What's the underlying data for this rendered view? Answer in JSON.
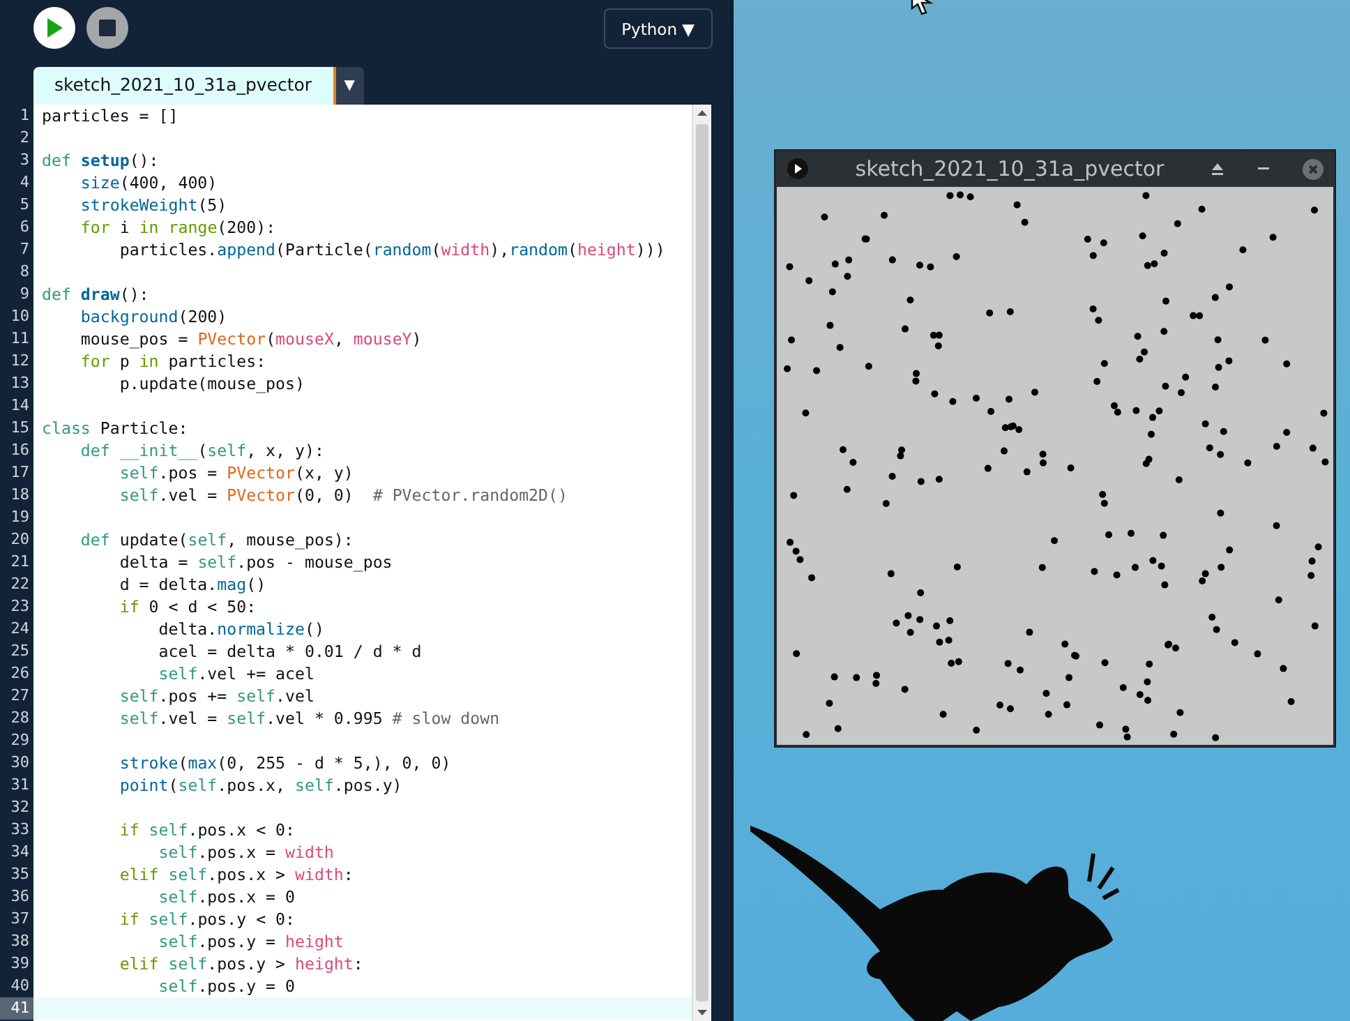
{
  "toolbar": {
    "language": "Python ▼"
  },
  "tabs": [
    {
      "label": "sketch_2021_10_31a_pvector",
      "selected": true
    }
  ],
  "tab_menu": "▼",
  "editor": {
    "lines": [
      {
        "number": "1",
        "current": false,
        "tokens": [
          {
            "t": "particles = []",
            "color": "#111111"
          }
        ]
      },
      {
        "number": "2",
        "current": false
      },
      {
        "number": "3",
        "current": false,
        "tokens": [
          {
            "t": "def ",
            "color": "#33997e"
          },
          {
            "t": "**setup**",
            "color": "#006699"
          },
          {
            "t": "():",
            "color": "#111111"
          }
        ]
      },
      {
        "number": "4",
        "current": false,
        "tokens": [
          {
            "t": "    size",
            "color": "#006699"
          },
          {
            "t": "(400, 400)",
            "color": "#111111"
          }
        ]
      },
      {
        "number": "5",
        "current": false,
        "tokens": [
          {
            "t": "    strokeWeight",
            "color": "#006699"
          },
          {
            "t": "(5)",
            "color": "#111111"
          }
        ]
      },
      {
        "number": "6",
        "current": false,
        "tokens": [
          {
            "t": "    for",
            "color": "#669900"
          },
          {
            "t": " i ",
            "color": "#111111"
          },
          {
            "t": "in range",
            "color": "#669900"
          },
          {
            "t": "(200):",
            "color": "#111111"
          }
        ]
      },
      {
        "number": "7",
        "current": false,
        "tokens": [
          {
            "t": "        particles.",
            "color": "#111111"
          },
          {
            "t": "append",
            "color": "#006699"
          },
          {
            "t": "(Particle(",
            "color": "#111111"
          },
          {
            "t": "random",
            "color": "#006699"
          },
          {
            "t": "(",
            "color": "#111111"
          },
          {
            "t": "width",
            "color": "#d94a7a"
          },
          {
            "t": "),",
            "color": "#111111"
          },
          {
            "t": "random",
            "color": "#006699"
          },
          {
            "t": "(",
            "color": "#111111"
          },
          {
            "t": "height",
            "color": "#d94a7a"
          },
          {
            "t": ")))",
            "color": "#111111"
          }
        ]
      },
      {
        "number": "8",
        "current": false
      },
      {
        "number": "9",
        "current": false,
        "tokens": [
          {
            "t": "def ",
            "color": "#33997e"
          },
          {
            "t": "**draw**",
            "color": "#006699"
          },
          {
            "t": "():",
            "color": "#111111"
          }
        ]
      },
      {
        "number": "10",
        "current": false,
        "tokens": [
          {
            "t": "    background",
            "color": "#006699"
          },
          {
            "t": "(200)",
            "color": "#111111"
          }
        ]
      },
      {
        "number": "11",
        "current": false,
        "tokens": [
          {
            "t": "    mouse_pos = ",
            "color": "#111111"
          },
          {
            "t": "PVector",
            "color": "#e2661a"
          },
          {
            "t": "(",
            "color": "#111111"
          },
          {
            "t": "mouseX",
            "color": "#d94a7a"
          },
          {
            "t": ", ",
            "color": "#111111"
          },
          {
            "t": "mouseY",
            "color": "#d94a7a"
          },
          {
            "t": ")",
            "color": "#111111"
          }
        ]
      },
      {
        "number": "12",
        "current": false,
        "tokens": [
          {
            "t": "    for",
            "color": "#669900"
          },
          {
            "t": " p ",
            "color": "#111111"
          },
          {
            "t": "in",
            "color": "#669900"
          },
          {
            "t": " particles:",
            "color": "#111111"
          }
        ]
      },
      {
        "number": "13",
        "current": false,
        "tokens": [
          {
            "t": "        p.update(mouse_pos)",
            "color": "#111111"
          }
        ]
      },
      {
        "number": "14",
        "current": false
      },
      {
        "number": "15",
        "current": false,
        "tokens": [
          {
            "t": "class",
            "color": "#33997e"
          },
          {
            "t": " Particle:",
            "color": "#111111"
          }
        ]
      },
      {
        "number": "16",
        "current": false,
        "tokens": [
          {
            "t": "    def __init__",
            "color": "#33997e"
          },
          {
            "t": "(",
            "color": "#111111"
          },
          {
            "t": "self",
            "color": "#33997e"
          },
          {
            "t": ", x, y):",
            "color": "#111111"
          }
        ]
      },
      {
        "number": "17",
        "current": false,
        "tokens": [
          {
            "t": "        self",
            "color": "#33997e"
          },
          {
            "t": ".pos = ",
            "color": "#111111"
          },
          {
            "t": "PVector",
            "color": "#e2661a"
          },
          {
            "t": "(x, y)",
            "color": "#111111"
          }
        ]
      },
      {
        "number": "18",
        "current": false,
        "tokens": [
          {
            "t": "        self",
            "color": "#33997e"
          },
          {
            "t": ".vel = ",
            "color": "#111111"
          },
          {
            "t": "PVector",
            "color": "#e2661a"
          },
          {
            "t": "(0, 0)",
            "color": "#111111"
          },
          {
            "t": "  # PVector.random2D()",
            "color": "#666666"
          }
        ]
      },
      {
        "number": "19",
        "current": false
      },
      {
        "number": "20",
        "current": false,
        "tokens": [
          {
            "t": "    def",
            "color": "#33997e"
          },
          {
            "t": " update(",
            "color": "#111111"
          },
          {
            "t": "self",
            "color": "#33997e"
          },
          {
            "t": ", mouse_pos):",
            "color": "#111111"
          }
        ]
      },
      {
        "number": "21",
        "current": false,
        "tokens": [
          {
            "t": "        delta = ",
            "color": "#111111"
          },
          {
            "t": "self",
            "color": "#33997e"
          },
          {
            "t": ".pos - mouse_pos",
            "color": "#111111"
          }
        ]
      },
      {
        "number": "22",
        "current": false,
        "tokens": [
          {
            "t": "        d = delta.",
            "color": "#111111"
          },
          {
            "t": "mag",
            "color": "#006699"
          },
          {
            "t": "()",
            "color": "#111111"
          }
        ]
      },
      {
        "number": "23",
        "current": false,
        "tokens": [
          {
            "t": "        if",
            "color": "#669900"
          },
          {
            "t": " 0 < d < 50:",
            "color": "#111111"
          }
        ]
      },
      {
        "number": "24",
        "current": false,
        "tokens": [
          {
            "t": "            delta.",
            "color": "#111111"
          },
          {
            "t": "normalize",
            "color": "#006699"
          },
          {
            "t": "()",
            "color": "#111111"
          }
        ]
      },
      {
        "number": "25",
        "current": false,
        "tokens": [
          {
            "t": "            acel = delta * 0.01 / d * d",
            "color": "#111111"
          }
        ]
      },
      {
        "number": "26",
        "current": false,
        "tokens": [
          {
            "t": "            self",
            "color": "#33997e"
          },
          {
            "t": ".vel += acel",
            "color": "#111111"
          }
        ]
      },
      {
        "number": "27",
        "current": false,
        "tokens": [
          {
            "t": "        self",
            "color": "#33997e"
          },
          {
            "t": ".pos += ",
            "color": "#111111"
          },
          {
            "t": "self",
            "color": "#33997e"
          },
          {
            "t": ".vel",
            "color": "#111111"
          }
        ]
      },
      {
        "number": "28",
        "current": false,
        "tokens": [
          {
            "t": "        self",
            "color": "#33997e"
          },
          {
            "t": ".vel = ",
            "color": "#111111"
          },
          {
            "t": "self",
            "color": "#33997e"
          },
          {
            "t": ".vel * 0.995",
            "color": "#111111"
          },
          {
            "t": " # slow down",
            "color": "#666666"
          }
        ]
      },
      {
        "number": "29",
        "current": false
      },
      {
        "number": "30",
        "current": false,
        "tokens": [
          {
            "t": "        stroke",
            "color": "#006699"
          },
          {
            "t": "(",
            "color": "#111111"
          },
          {
            "t": "max",
            "color": "#006699"
          },
          {
            "t": "(0, 255 - d * 5,), 0, 0)",
            "color": "#111111"
          }
        ]
      },
      {
        "number": "31",
        "current": false,
        "tokens": [
          {
            "t": "        point",
            "color": "#006699"
          },
          {
            "t": "(",
            "color": "#111111"
          },
          {
            "t": "self",
            "color": "#33997e"
          },
          {
            "t": ".pos.x, ",
            "color": "#111111"
          },
          {
            "t": "self",
            "color": "#33997e"
          },
          {
            "t": ".pos.y)",
            "color": "#111111"
          }
        ]
      },
      {
        "number": "32",
        "current": false
      },
      {
        "number": "33",
        "current": false,
        "tokens": [
          {
            "t": "        if",
            "color": "#669900"
          },
          {
            "t": " self",
            "color": "#33997e"
          },
          {
            "t": ".pos.x < 0:",
            "color": "#111111"
          }
        ]
      },
      {
        "number": "34",
        "current": false,
        "tokens": [
          {
            "t": "            self",
            "color": "#33997e"
          },
          {
            "t": ".pos.x = ",
            "color": "#111111"
          },
          {
            "t": "width",
            "color": "#d94a7a"
          }
        ]
      },
      {
        "number": "35",
        "current": false,
        "tokens": [
          {
            "t": "        elif",
            "color": "#669900"
          },
          {
            "t": " self",
            "color": "#33997e"
          },
          {
            "t": ".pos.x > ",
            "color": "#111111"
          },
          {
            "t": "width",
            "color": "#d94a7a"
          },
          {
            "t": ":",
            "color": "#111111"
          }
        ]
      },
      {
        "number": "36",
        "current": false,
        "tokens": [
          {
            "t": "            self",
            "color": "#33997e"
          },
          {
            "t": ".pos.x = 0",
            "color": "#111111"
          }
        ]
      },
      {
        "number": "37",
        "current": false,
        "tokens": [
          {
            "t": "        if",
            "color": "#669900"
          },
          {
            "t": " self",
            "color": "#33997e"
          },
          {
            "t": ".pos.y < 0:",
            "color": "#111111"
          }
        ]
      },
      {
        "number": "38",
        "current": false,
        "tokens": [
          {
            "t": "            self",
            "color": "#33997e"
          },
          {
            "t": ".pos.y = ",
            "color": "#111111"
          },
          {
            "t": "height",
            "color": "#d94a7a"
          }
        ]
      },
      {
        "number": "39",
        "current": false,
        "tokens": [
          {
            "t": "        elif",
            "color": "#669900"
          },
          {
            "t": " self",
            "color": "#33997e"
          },
          {
            "t": ".pos.y > ",
            "color": "#111111"
          },
          {
            "t": "height",
            "color": "#d94a7a"
          },
          {
            "t": ":",
            "color": "#111111"
          }
        ]
      },
      {
        "number": "40",
        "current": false,
        "tokens": [
          {
            "t": "            self",
            "color": "#33997e"
          },
          {
            "t": ".pos.y = 0",
            "color": "#111111"
          }
        ]
      },
      {
        "number": "41",
        "current": true
      }
    ]
  },
  "sketch_window": {
    "title": "sketch_2021_10_31a_pvector"
  }
}
